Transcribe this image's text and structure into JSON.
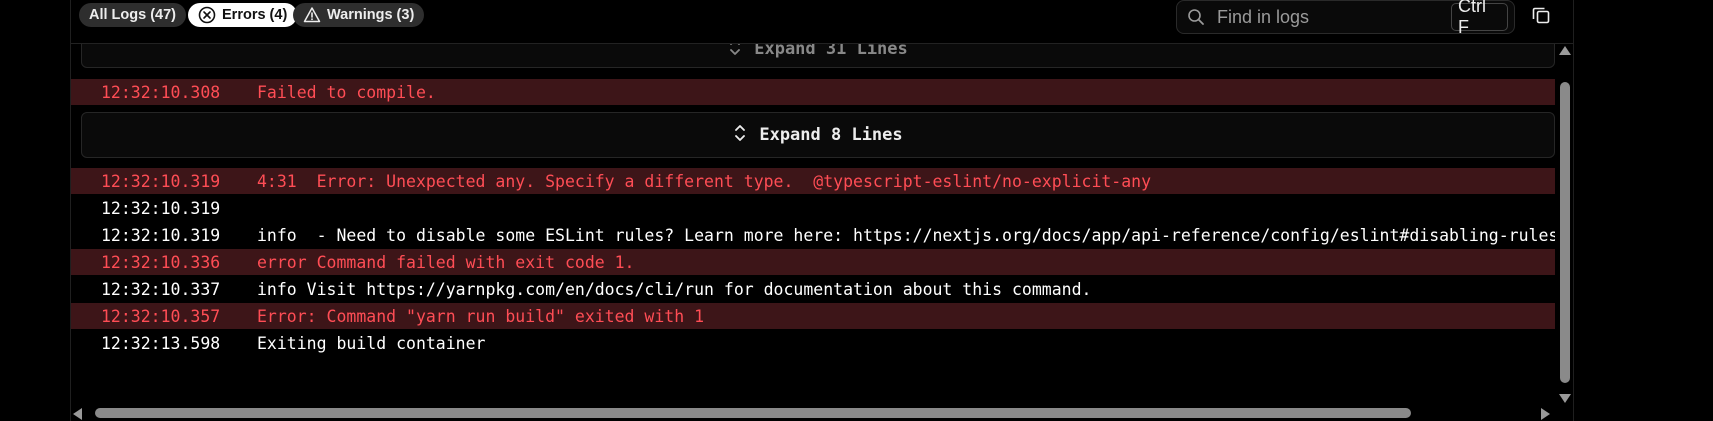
{
  "filters": {
    "all_label": "All Logs (47)",
    "errors_label": "Errors (4)",
    "warnings_label": "Warnings (3)"
  },
  "search": {
    "placeholder": "Find in logs",
    "shortcut": "Ctrl F"
  },
  "expand_top_label": "Expand 31 Lines",
  "expand_mid_label": "Expand 8 Lines",
  "log_rows": [
    {
      "time": "12:32:10.308",
      "text": "Failed to compile.",
      "level": "error"
    },
    {
      "time": "12:32:10.319",
      "text": "4:31  Error: Unexpected any. Specify a different type.  @typescript-eslint/no-explicit-any",
      "level": "error"
    },
    {
      "time": "12:32:10.319",
      "text": "",
      "level": "info"
    },
    {
      "time": "12:32:10.319",
      "text": "info  - Need to disable some ESLint rules? Learn more here: https://nextjs.org/docs/app/api-reference/config/eslint#disabling-rules",
      "level": "info"
    },
    {
      "time": "12:32:10.336",
      "text": "error Command failed with exit code 1.",
      "level": "error"
    },
    {
      "time": "12:32:10.337",
      "text": "info Visit https://yarnpkg.com/en/docs/cli/run for documentation about this command.",
      "level": "info"
    },
    {
      "time": "12:32:10.357",
      "text": "Error: Command \"yarn run build\" exited with 1",
      "level": "error"
    },
    {
      "time": "12:32:13.598",
      "text": "Exiting build container",
      "level": "info"
    }
  ],
  "colors": {
    "error_text": "#ff4d55",
    "error_row_bg": "#3d1518",
    "background": "#000000"
  },
  "icons": {
    "errors_pill": "circle-x-icon",
    "warnings_pill": "warning-triangle-icon",
    "search": "search-icon",
    "copy": "copy-icon",
    "expand": "chevron-up-down-icon"
  }
}
